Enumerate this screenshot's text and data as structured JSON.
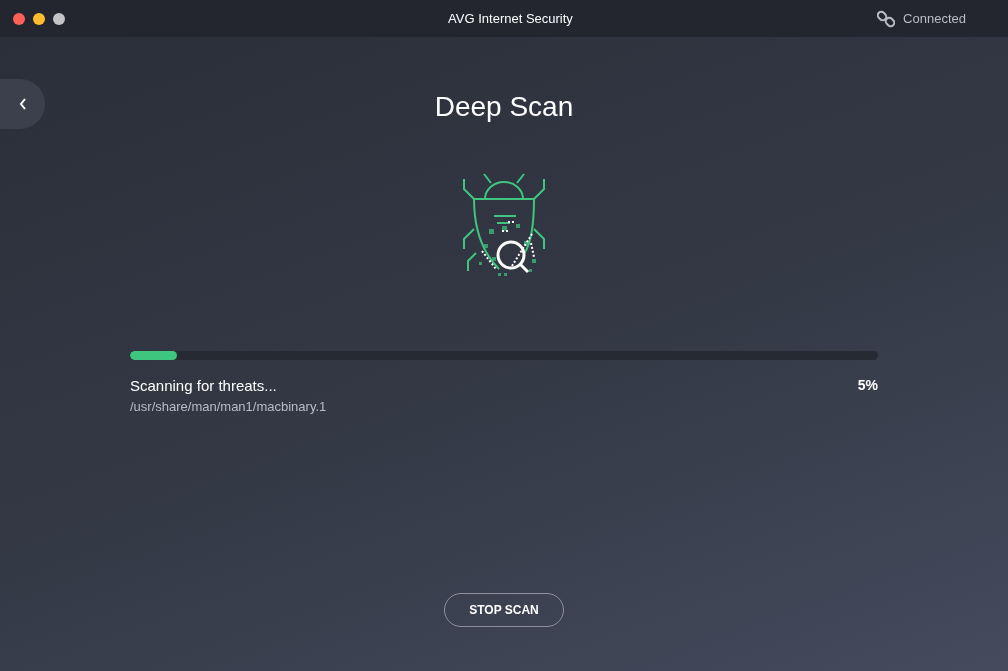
{
  "window": {
    "title": "AVG Internet Security",
    "connection": "Connected"
  },
  "page": {
    "title": "Deep Scan"
  },
  "progress": {
    "level": 0.063,
    "status": "Scanning for threats...",
    "path": "/usr/share/man/man1/macbinary.1",
    "percent": "5%"
  },
  "buttons": [
    {
      "label": "STOP SCAN"
    }
  ]
}
